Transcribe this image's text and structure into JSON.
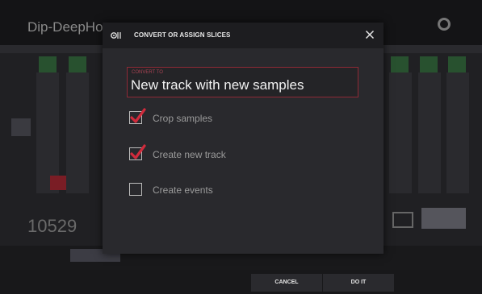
{
  "background": {
    "project_name": "Dip-DeepHous",
    "counter": "10529"
  },
  "dialog": {
    "title": "CONVERT OR ASSIGN SLICES",
    "convert_to": {
      "label": "CONVERT TO",
      "value": "New track with new samples"
    },
    "options": [
      {
        "label": "Crop samples",
        "checked": true
      },
      {
        "label": "Create new track",
        "checked": true
      },
      {
        "label": "Create events",
        "checked": false
      }
    ]
  },
  "footer": {
    "cancel_label": "CANCEL",
    "do_it_label": "DO IT"
  },
  "colors": {
    "accent_red": "#d12b3c",
    "dialog_bg": "#29292d",
    "header_bg": "#1d1d20"
  },
  "icons": {
    "dialog": "slices-icon",
    "close": "close-icon",
    "check": "checkmark-icon"
  }
}
